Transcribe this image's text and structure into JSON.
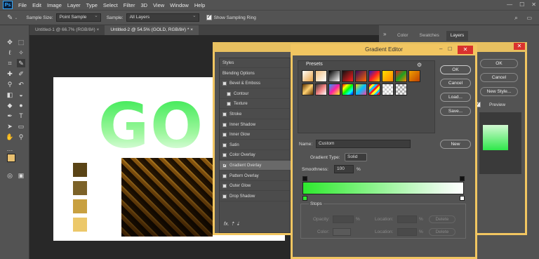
{
  "app": {
    "logo": "Ps"
  },
  "menu": [
    "File",
    "Edit",
    "Image",
    "Layer",
    "Type",
    "Select",
    "Filter",
    "3D",
    "View",
    "Window",
    "Help"
  ],
  "options_bar": {
    "sample_size_label": "Sample Size:",
    "sample_size_value": "Point Sample",
    "sample_label": "Sample:",
    "sample_value": "All Layers",
    "show_ring_label": "Show Sampling Ring"
  },
  "doc_tabs": [
    {
      "label": "Untitled-1 @ 66.7% (RGB/8#)",
      "close": "×"
    },
    {
      "label": "Untitled-2 @ 54.5% (GOLD, RGB/8#) *",
      "close": "×"
    }
  ],
  "canvas": {
    "text": "GO",
    "swatch_colors": [
      "#5a4416",
      "#7c6228",
      "#c8a040",
      "#ecc86a"
    ]
  },
  "right_panel_tabs": [
    "Color",
    "Swatches",
    "Layers"
  ],
  "layer_style": {
    "styles_list": [
      {
        "label": "Styles",
        "checkbox": false,
        "indent": false
      },
      {
        "label": "Blending Options",
        "checkbox": false,
        "indent": false
      },
      {
        "label": "Bevel & Emboss",
        "checkbox": true,
        "indent": false
      },
      {
        "label": "Contour",
        "checkbox": true,
        "indent": true
      },
      {
        "label": "Texture",
        "checkbox": true,
        "indent": true
      },
      {
        "label": "Stroke",
        "checkbox": true,
        "indent": false
      },
      {
        "label": "Inner Shadow",
        "checkbox": true,
        "indent": false
      },
      {
        "label": "Inner Glow",
        "checkbox": true,
        "indent": false
      },
      {
        "label": "Satin",
        "checkbox": true,
        "indent": false
      },
      {
        "label": "Color Overlay",
        "checkbox": true,
        "indent": false
      },
      {
        "label": "Gradient Overlay",
        "checkbox": true,
        "indent": false,
        "selected": true,
        "checked": true
      },
      {
        "label": "Pattern Overlay",
        "checkbox": true,
        "indent": false
      },
      {
        "label": "Outer Glow",
        "checkbox": true,
        "indent": false
      },
      {
        "label": "Drop Shadow",
        "checkbox": true,
        "indent": false
      }
    ],
    "fx_label": "fx.",
    "ok": "OK",
    "cancel": "Cancel",
    "new_style": "New Style...",
    "preview": "Preview"
  },
  "gradient_editor": {
    "title": "Gradient Editor",
    "presets_label": "Presets",
    "ok": "OK",
    "cancel": "Cancel",
    "load": "Load...",
    "save": "Save...",
    "name_label": "Name:",
    "name_value": "Custom",
    "new_button": "New",
    "gradient_type_label": "Gradient Type:",
    "gradient_type_value": "Solid",
    "smoothness_label": "Smoothness:",
    "smoothness_value": "100",
    "smoothness_unit": "%",
    "stops_label": "Stops",
    "opacity_label": "Opacity:",
    "color_label": "Color:",
    "location_label": "Location:",
    "pct": "%",
    "delete": "Delete",
    "gradient_colors": [
      "#2eea2e",
      "#ffffff"
    ]
  }
}
